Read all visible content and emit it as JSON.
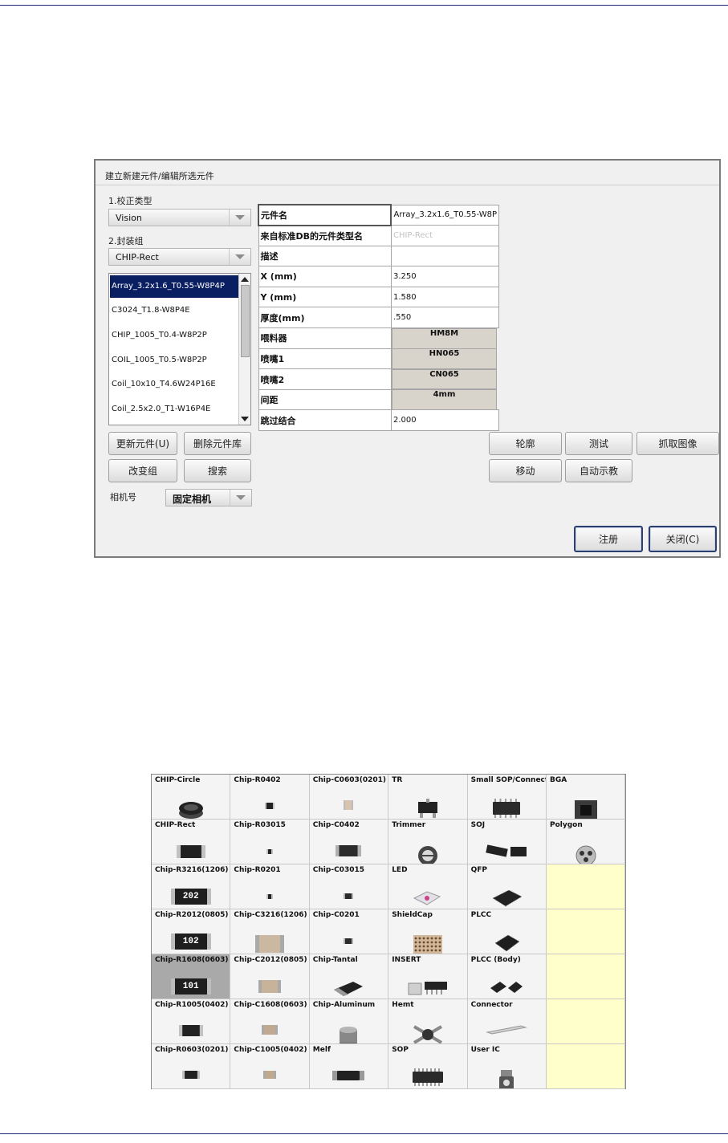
{
  "dialog": {
    "title": "建立新建元件/编辑所选元件",
    "correction_type_label": "1.校正类型",
    "correction_type_value": "Vision",
    "package_group_label": "2.封装组",
    "package_group_value": "CHIP-Rect",
    "list_items": [
      "Array_3.2x1.6_T0.55-W8P4P",
      "C3024_T1.8-W8P4E",
      "CHIP_1005_T0.4-W8P2P",
      "COIL_1005_T0.5-W8P2P",
      "Coil_10x10_T4.6W24P16E",
      "Coil_2.5x2.0_T1-W16P4E"
    ],
    "buttons": {
      "update": "更新元件(U)",
      "delete": "删除元件库",
      "change_group": "改变组",
      "search": "搜索",
      "contour": "轮廓",
      "test": "测试",
      "capture": "抓取图像",
      "move": "移动",
      "auto_teach": "自动示教",
      "register": "注册",
      "close": "关闭(C)"
    },
    "camera_label": "相机号",
    "camera_value": "固定相机",
    "properties": [
      {
        "key": "元件名",
        "value": "Array_3.2x1.6_T0.55-W8P",
        "style": "text"
      },
      {
        "key": "来自标准DB的元件类型名",
        "value": "CHIP-Rect",
        "style": "grey"
      },
      {
        "key": "描述",
        "value": "",
        "style": "text"
      },
      {
        "key": "X (mm)",
        "value": "3.250",
        "style": "text"
      },
      {
        "key": "Y (mm)",
        "value": "1.580",
        "style": "text"
      },
      {
        "key": "厚度(mm)",
        "value": ".550",
        "style": "text"
      },
      {
        "key": "喂料器",
        "value": "HM8M",
        "style": "cell"
      },
      {
        "key": "喷嘴1",
        "value": "HN065",
        "style": "cell"
      },
      {
        "key": "喷嘴2",
        "value": "CN065",
        "style": "cell"
      },
      {
        "key": "间距",
        "value": "4mm",
        "style": "cell"
      },
      {
        "key": "跳过结合",
        "value": "2.000",
        "style": "text"
      }
    ]
  },
  "packages": [
    [
      "CHIP-Circle",
      "Chip-R0402",
      "Chip-C0603(0201)",
      "TR",
      "Small SOP/Connector",
      "BGA"
    ],
    [
      "CHIP-Rect",
      "Chip-R03015",
      "Chip-C0402",
      "Trimmer",
      "SOJ",
      "Polygon"
    ],
    [
      "Chip-R3216(1206)",
      "Chip-R0201",
      "Chip-C03015",
      "LED",
      "QFP",
      ""
    ],
    [
      "Chip-R2012(0805)",
      "Chip-C3216(1206)",
      "Chip-C0201",
      "ShieldCap",
      "PLCC",
      ""
    ],
    [
      "Chip-R1608(0603)",
      "Chip-C2012(0805)",
      "Chip-Tantal",
      "INSERT",
      "PLCC (Body)",
      ""
    ],
    [
      "Chip-R1005(0402)",
      "Chip-C1608(0603)",
      "Chip-Aluminum",
      "Hemt",
      "Connector",
      ""
    ],
    [
      "Chip-R0603(0201)",
      "Chip-C1005(0402)",
      "Melf",
      "SOP",
      "User IC",
      ""
    ]
  ],
  "selected_package": "Chip-R1608(0603)",
  "resistor_marks": {
    "r3216": "202",
    "r2012": "102",
    "r1608": "101"
  }
}
